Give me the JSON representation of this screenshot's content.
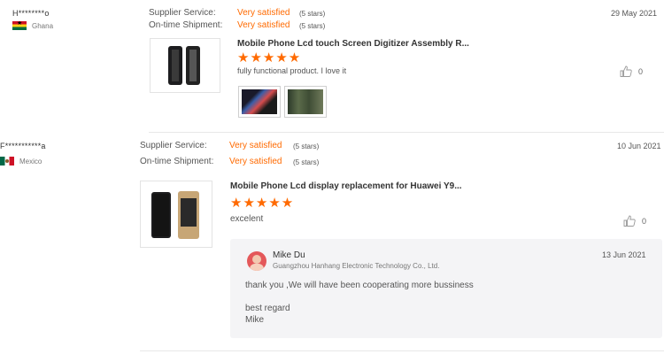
{
  "reviews": [
    {
      "buyer": "H********o",
      "country": "Ghana",
      "flag": "ghana-flag",
      "supplier_label": "Supplier Service:",
      "supplier_value": "Very satisfied",
      "supplier_stars": "(5 stars)",
      "shipment_label": "On-time Shipment:",
      "shipment_value": "Very satisfied",
      "shipment_stars": "(5 stars)",
      "date": "29 May 2021",
      "product": "Mobile Phone Lcd touch Screen Digitizer Assembly R...",
      "rating_stars": "★★★★★",
      "rating": 5,
      "comment": "fully  functional product. I love it",
      "likes": "0"
    },
    {
      "buyer": "F***********a",
      "country": "Mexico",
      "flag": "mexico-flag",
      "supplier_label": "Supplier Service:",
      "supplier_value": "Very satisfied",
      "supplier_stars": "(5 stars)",
      "shipment_label": "On-time Shipment:",
      "shipment_value": "Very satisfied",
      "shipment_stars": "(5 stars)",
      "date": "10 Jun 2021",
      "product": "Mobile Phone Lcd display replacement for Huawei Y9...",
      "rating_stars": "★★★★★",
      "rating": 5,
      "comment": "excelent",
      "likes": "0",
      "reply": {
        "name": "Mike Du",
        "company": "Guangzhou Hanhang Electronic Technology Co., Ltd.",
        "date": "13 Jun 2021",
        "line1": "thank you ,We will have been cooperating more bussiness",
        "line2": "best regard",
        "line3": "Mike"
      }
    }
  ],
  "colors": {
    "accent": "#ff6a00",
    "reply_bg": "#f4f4f6",
    "divider": "#e8e8e8"
  },
  "icons": {
    "like": "thumbs-up-icon"
  }
}
